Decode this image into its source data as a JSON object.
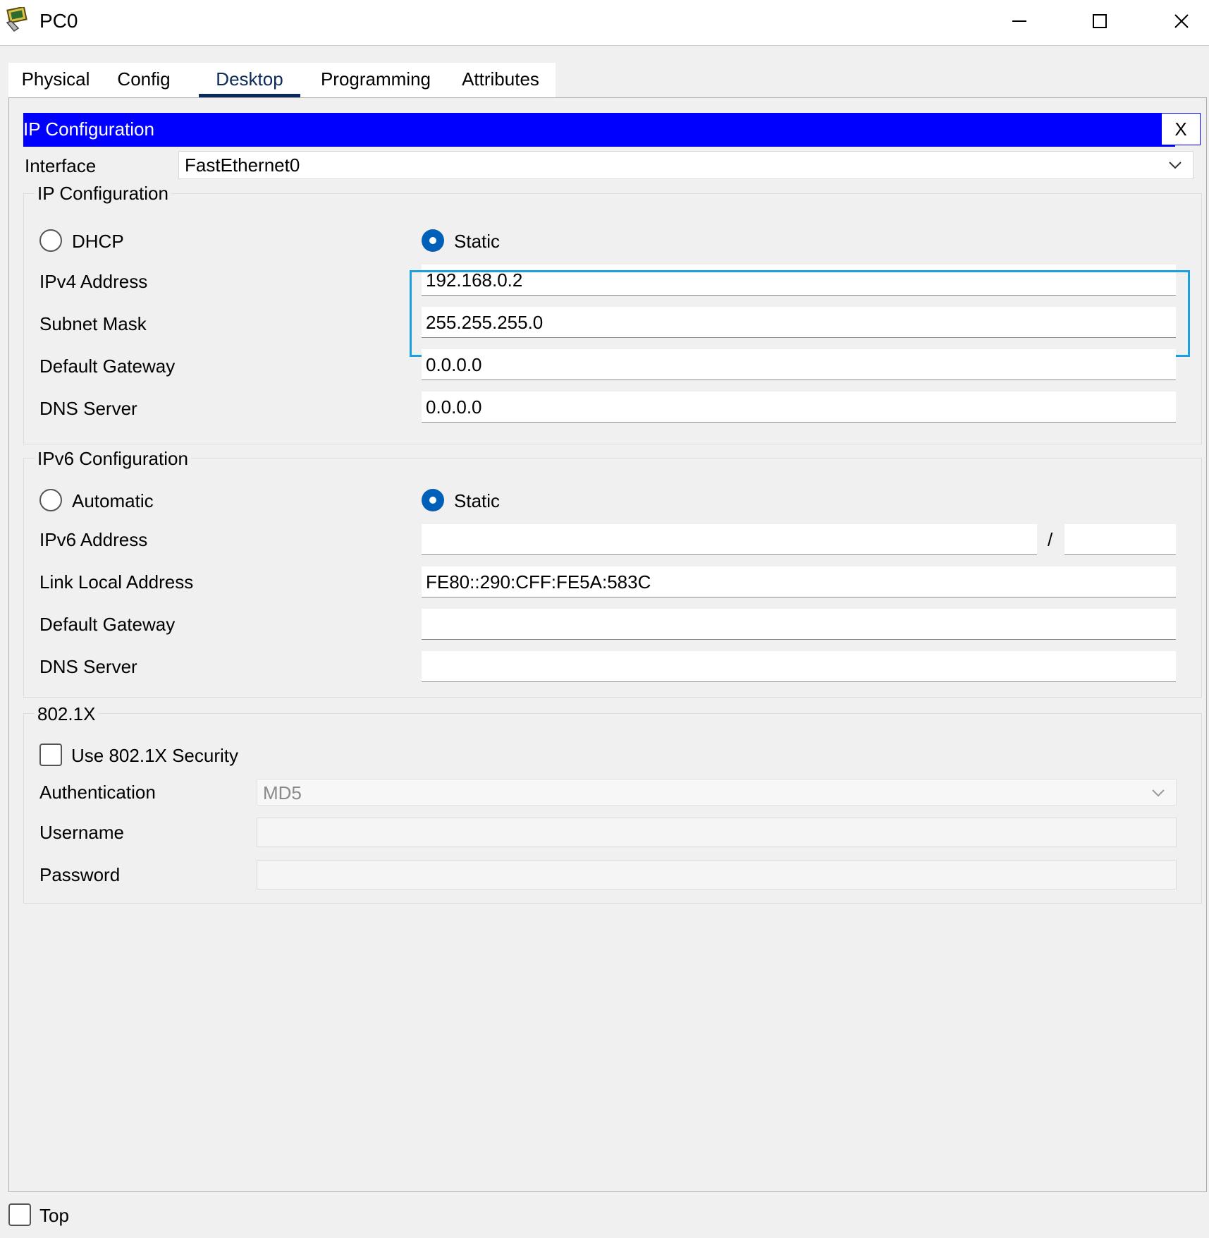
{
  "window": {
    "title": "PC0",
    "icon": "pc-app-icon",
    "controls": [
      "minimize-icon",
      "maximize-icon",
      "close-icon"
    ]
  },
  "tabs": [
    {
      "label": "Physical"
    },
    {
      "label": "Config"
    },
    {
      "label": "Desktop",
      "active": true
    },
    {
      "label": "Programming"
    },
    {
      "label": "Attributes"
    }
  ],
  "ip_config_window": {
    "title": "IP Configuration",
    "close_label": "X",
    "interface_label": "Interface",
    "interface_value": "FastEthernet0"
  },
  "ipv4": {
    "group_title": "IP Configuration",
    "dhcp_label": "DHCP",
    "static_label": "Static",
    "mode": "Static",
    "address_label": "IPv4 Address",
    "address_value": "192.168.0.2",
    "mask_label": "Subnet Mask",
    "mask_value": "255.255.255.0",
    "gateway_label": "Default Gateway",
    "gateway_value": "0.0.0.0",
    "dns_label": "DNS Server",
    "dns_value": "0.0.0.0"
  },
  "ipv6": {
    "group_title": "IPv6 Configuration",
    "auto_label": "Automatic",
    "static_label": "Static",
    "mode": "Static",
    "address_label": "IPv6 Address",
    "address_value": "",
    "prefix_separator": "/",
    "prefix_value": "",
    "link_local_label": "Link Local Address",
    "link_local_value": "FE80::290:CFF:FE5A:583C",
    "gateway_label": "Default Gateway",
    "gateway_value": "",
    "dns_label": "DNS Server",
    "dns_value": ""
  },
  "dot1x": {
    "group_title": "802.1X",
    "use_security_label": "Use 802.1X Security",
    "use_security_checked": false,
    "auth_label": "Authentication",
    "auth_value": "MD5",
    "username_label": "Username",
    "username_value": "",
    "password_label": "Password",
    "password_value": ""
  },
  "footer": {
    "top_label": "Top",
    "top_checked": false
  },
  "colors": {
    "header_blue": "#0000ff",
    "radio_blue": "#005fb8",
    "tab_active": "#0d2a5c",
    "highlight": "#1aa0e0"
  }
}
